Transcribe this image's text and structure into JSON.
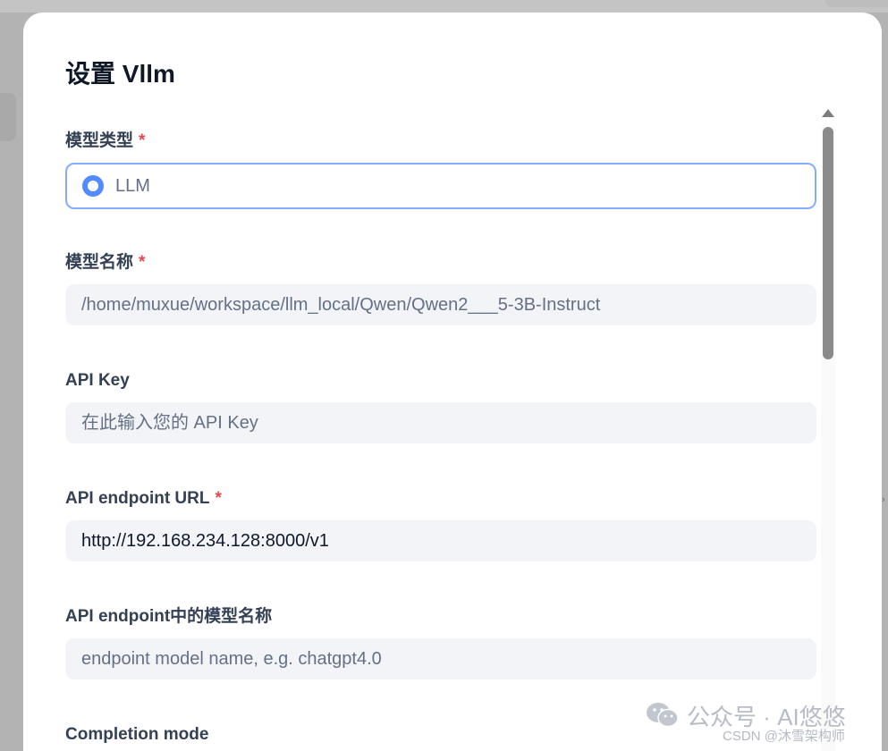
{
  "modal": {
    "title": "设置 Vllm"
  },
  "fields": {
    "model_type": {
      "label": "模型类型",
      "required_mark": "*",
      "option_label": "LLM"
    },
    "model_name": {
      "label": "模型名称",
      "required_mark": "*",
      "value": "/home/muxue/workspace/llm_local/Qwen/Qwen2___5-3B-Instruct"
    },
    "api_key": {
      "label": "API Key",
      "placeholder": "在此输入您的 API Key"
    },
    "endpoint_url": {
      "label": "API endpoint URL",
      "required_mark": "*",
      "value": "http://192.168.234.128:8000/v1"
    },
    "endpoint_model_name": {
      "label": "API endpoint中的模型名称",
      "placeholder": "endpoint model name, e.g. chatgpt4.0"
    },
    "completion_mode": {
      "label": "Completion mode"
    }
  },
  "watermark": {
    "text": "公众号 · AI悠悠",
    "source": "CSDN @沐雪架构师",
    "icon": "wechat-icon"
  },
  "colors": {
    "accent": "#528bff",
    "required": "#e5484d",
    "input_bg": "#f2f4f7"
  }
}
